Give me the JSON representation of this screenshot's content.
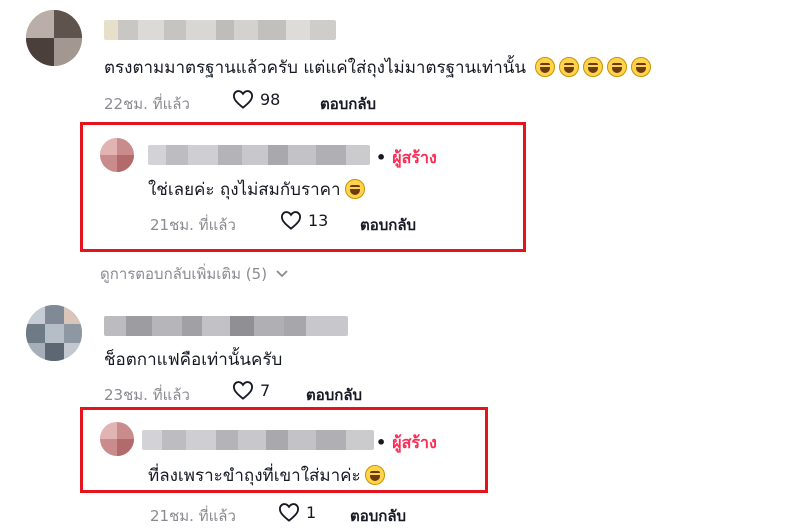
{
  "comments": [
    {
      "text": "ตรงตามมาตรฐานแล้วครับ แต่แค่ใส่ถุงไม่มาตรฐานเท่านั้น",
      "emoji_count": 5,
      "time": "22ชม. ที่แล้ว",
      "likes": "98",
      "reply_label": "ตอบกลับ",
      "replies": [
        {
          "creator_label": "ผู้สร้าง",
          "text": "ใช่เลยค่ะ ถุงไม่สมกับราคา",
          "time": "21ชม. ที่แล้ว",
          "likes": "13",
          "reply_label": "ตอบกลับ"
        }
      ],
      "more_replies": "ดูการตอบกลับเพิ่มเติม (5)"
    },
    {
      "text": "ช็อตกาแฟคือเท่านั้นครับ",
      "time": "23ชม. ที่แล้ว",
      "likes": "7",
      "reply_label": "ตอบกลับ",
      "replies": [
        {
          "creator_label": "ผู้สร้าง",
          "text": "ที่ลงเพราะขำถุงที่เขาใส่มาค่ะ",
          "time": "21ชม. ที่แล้ว",
          "likes": "1",
          "reply_label": "ตอบกลับ"
        }
      ]
    }
  ],
  "colors": {
    "creator": "#fe2c55",
    "highlight_box": "#e3141c",
    "meta": "#8a8b91"
  },
  "icons": [
    "heart-icon",
    "chevron-down-icon",
    "laughing-emoji-icon"
  ]
}
